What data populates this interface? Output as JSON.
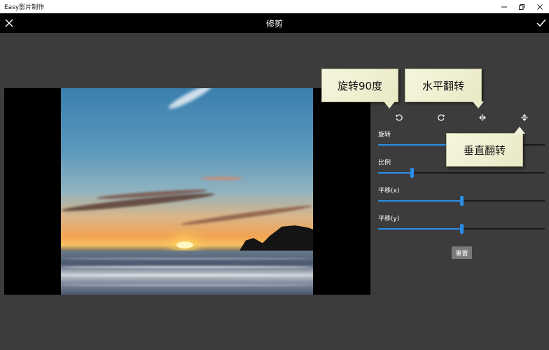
{
  "window": {
    "title": "Easy影片制作",
    "min_icon": "minimize-icon",
    "max_icon": "restore-icon",
    "close_icon": "close-window-icon"
  },
  "header": {
    "title": "修剪",
    "cancel_icon": "close-icon",
    "confirm_icon": "checkmark-icon"
  },
  "preview": {
    "image": "sunset-over-sea-photo"
  },
  "tools": [
    {
      "name": "rotate-left-icon"
    },
    {
      "name": "rotate-right-icon"
    },
    {
      "name": "flip-horizontal-icon"
    },
    {
      "name": "flip-vertical-icon"
    }
  ],
  "sliders": [
    {
      "label": "旋转",
      "value": 0.5
    },
    {
      "label": "比例",
      "value": 0.2
    },
    {
      "label": "平移(x)",
      "value": 0.5
    },
    {
      "label": "平移(y)",
      "value": 0.5
    }
  ],
  "reset_label": "重置",
  "callouts": {
    "rotate": "旋转90度",
    "flip_h": "水平翻转",
    "flip_v": "垂直翻转"
  },
  "colors": {
    "accent": "#2a8ee8",
    "background": "#3c3c3c",
    "header": "#000000",
    "callout": "#f1f1d6"
  }
}
